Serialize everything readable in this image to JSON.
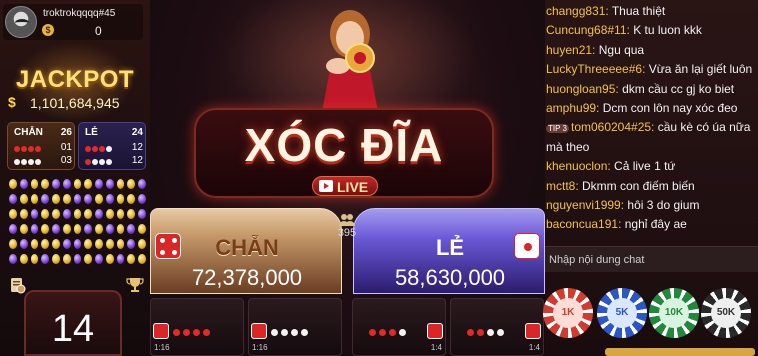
{
  "user": {
    "name": "troktrokqqqq#45",
    "currency_symbol": "$",
    "balance": "0"
  },
  "jackpot": {
    "title": "JACKPOT",
    "currency": "$",
    "amount": "1,101,684,945"
  },
  "stats": {
    "chan": {
      "label": "CHẴN",
      "count": "26",
      "row1": "01",
      "row2": "03"
    },
    "le": {
      "label": "LẺ",
      "count": "24",
      "row1": "12",
      "row2": "12"
    }
  },
  "history_rows": [
    [
      "y",
      "p",
      "y",
      "y",
      "p",
      "p",
      "y",
      "y",
      "p",
      "p",
      "y",
      "y",
      "p"
    ],
    [
      "p",
      "y",
      "y",
      "p",
      "y",
      "y",
      "p",
      "p",
      "y",
      "p",
      "y",
      "y",
      "p"
    ],
    [
      "y",
      "y",
      "p",
      "y",
      "y",
      "p",
      "y",
      "y",
      "p",
      "y",
      "y",
      "y",
      "p"
    ],
    [
      "p",
      "y",
      "p",
      "y",
      "p",
      "y",
      "y",
      "p",
      "y",
      "p",
      "y",
      "p",
      "y"
    ],
    [
      "y",
      "p",
      "y",
      "y",
      "y",
      "p",
      "p",
      "y",
      "y",
      "y",
      "y",
      "p",
      "y"
    ],
    [
      "p",
      "y",
      "y",
      "p",
      "y",
      "y",
      "p",
      "y",
      "p",
      "y",
      "p",
      "y",
      "y"
    ]
  ],
  "round": {
    "number": "14"
  },
  "game": {
    "title": "XÓC ĐĨA",
    "live": "LIVE",
    "players": "395"
  },
  "bets": {
    "chan": {
      "label": "CHẴN",
      "amount": "72,378,000"
    },
    "le": {
      "label": "LẺ",
      "amount": "58,630,000"
    }
  },
  "sub_bets": [
    {
      "ratio": "1:16",
      "dots": [
        "red",
        "red",
        "red",
        "red"
      ]
    },
    {
      "ratio": "1:16",
      "dots": [
        "wht",
        "wht",
        "wht",
        "wht"
      ]
    },
    {
      "ratio": "1:4",
      "dots": [
        "red",
        "red",
        "red",
        "wht"
      ]
    },
    {
      "ratio": "1:4",
      "dots": [
        "red",
        "red",
        "wht",
        "wht"
      ]
    }
  ],
  "chat": {
    "messages": [
      {
        "user": "changg831:",
        "text": " Thua thiệt"
      },
      {
        "user": "Cuncung68#11:",
        "text": " K tu luon kkk"
      },
      {
        "user": "huyen21:",
        "text": " Ngu qua"
      },
      {
        "user": "LuckyThreeeee#6:",
        "text": " Vừa ăn lại giết luôn"
      },
      {
        "user": "huongloan95:",
        "text": " dkm cầu cc gj ko biet"
      },
      {
        "user": "amphu99:",
        "text": " Dcm con lôn nay xóc đeo"
      },
      {
        "user": "tom060204#25:",
        "text": " cầu kè có úa nữa",
        "tip": "TIP 3"
      },
      {
        "user": "",
        "text": "mà theo"
      },
      {
        "user": "khenuoclon:",
        "text": " Cả live 1 tứ"
      },
      {
        "user": "mctt8:",
        "text": " Dkmm con điếm biến"
      },
      {
        "user": "nguyenvi1999:",
        "text": " hôi 3 do gium"
      },
      {
        "user": "baconcua191:",
        "text": " nghỉ đây ae"
      }
    ],
    "placeholder": "Nhập nội dung chat"
  },
  "chips": [
    "1K",
    "5K",
    "10K",
    "50K"
  ]
}
